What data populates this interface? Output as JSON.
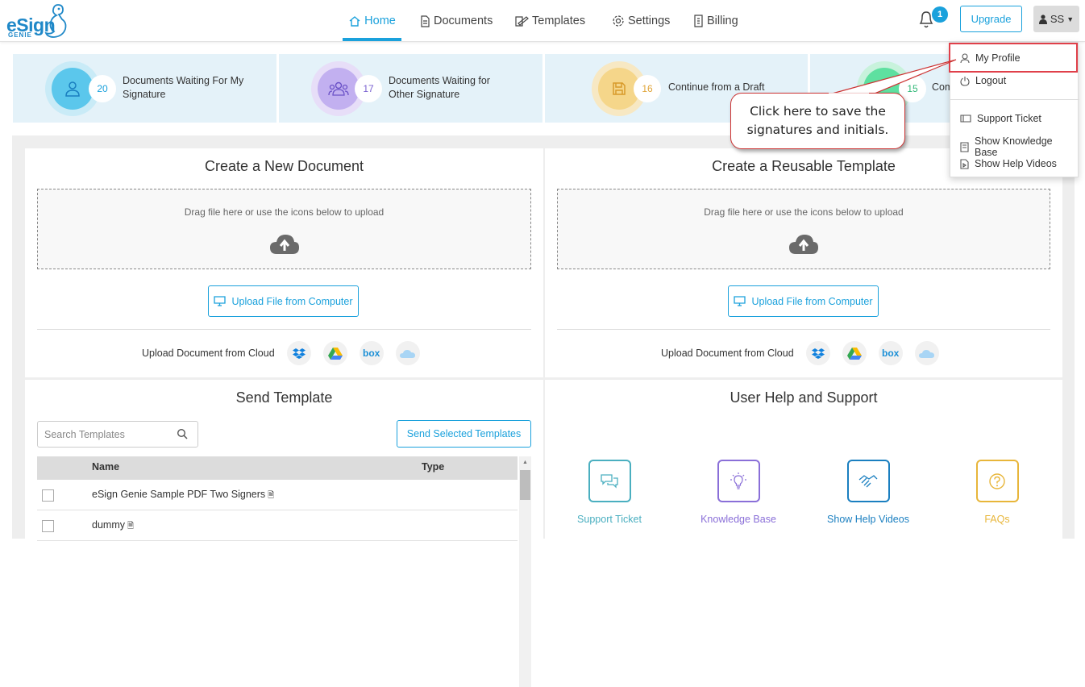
{
  "logo": {
    "text": "eSign",
    "sub": "GENIE"
  },
  "nav": {
    "home": "Home",
    "documents": "Documents",
    "templates": "Templates",
    "settings": "Settings",
    "billing": "Billing"
  },
  "header": {
    "notification_count": "1",
    "upgrade_label": "Upgrade",
    "user_initials": "SS"
  },
  "stats": [
    {
      "count": "20",
      "line1": "Documents Waiting For My",
      "line2": "Signature",
      "color": "#5bc7ec"
    },
    {
      "count": "17",
      "line1": "Documents Waiting for",
      "line2": "Other Signature",
      "color": "#a68be0"
    },
    {
      "count": "16",
      "line1": "Continue from a Draft",
      "line2": "",
      "color": "#f2c45a"
    },
    {
      "count": "15",
      "line1": "Com",
      "line2": "",
      "color": "#5ee0a0"
    }
  ],
  "create_document": {
    "title": "Create a New Document",
    "drop_text": "Drag file here or use the icons below to upload",
    "upload_label": "Upload File from Computer",
    "cloud_label": "Upload Document from Cloud"
  },
  "create_template": {
    "title": "Create a Reusable Template",
    "drop_text": "Drag file here or use the icons below to upload",
    "upload_label": "Upload File from Computer",
    "cloud_label": "Upload Document from Cloud"
  },
  "send_template": {
    "title": "Send Template",
    "search_placeholder": "Search Templates",
    "send_label": "Send Selected Templates",
    "columns": {
      "name": "Name",
      "type": "Type"
    },
    "rows": [
      {
        "name": "eSign Genie Sample PDF Two Signers"
      },
      {
        "name": "dummy"
      }
    ]
  },
  "help": {
    "title": "User Help and Support",
    "items": [
      {
        "label": "Support Ticket",
        "color": "#4aafc0",
        "icon": "chat-icon"
      },
      {
        "label": "Knowledge Base",
        "color": "#8a6fd8",
        "icon": "lightbulb-icon"
      },
      {
        "label": "Show Help Videos",
        "color": "#1a7fc0",
        "icon": "handshake-icon"
      },
      {
        "label": "FAQs",
        "color": "#e8b63a",
        "icon": "question-icon"
      }
    ]
  },
  "dropdown": {
    "my_profile": "My Profile",
    "logout": "Logout",
    "support_ticket": "Support Ticket",
    "knowledge_base": "Show Knowledge Base",
    "help_videos": "Show Help Videos"
  },
  "callout": {
    "line1": "Click here to save the",
    "line2": "signatures and initials."
  }
}
